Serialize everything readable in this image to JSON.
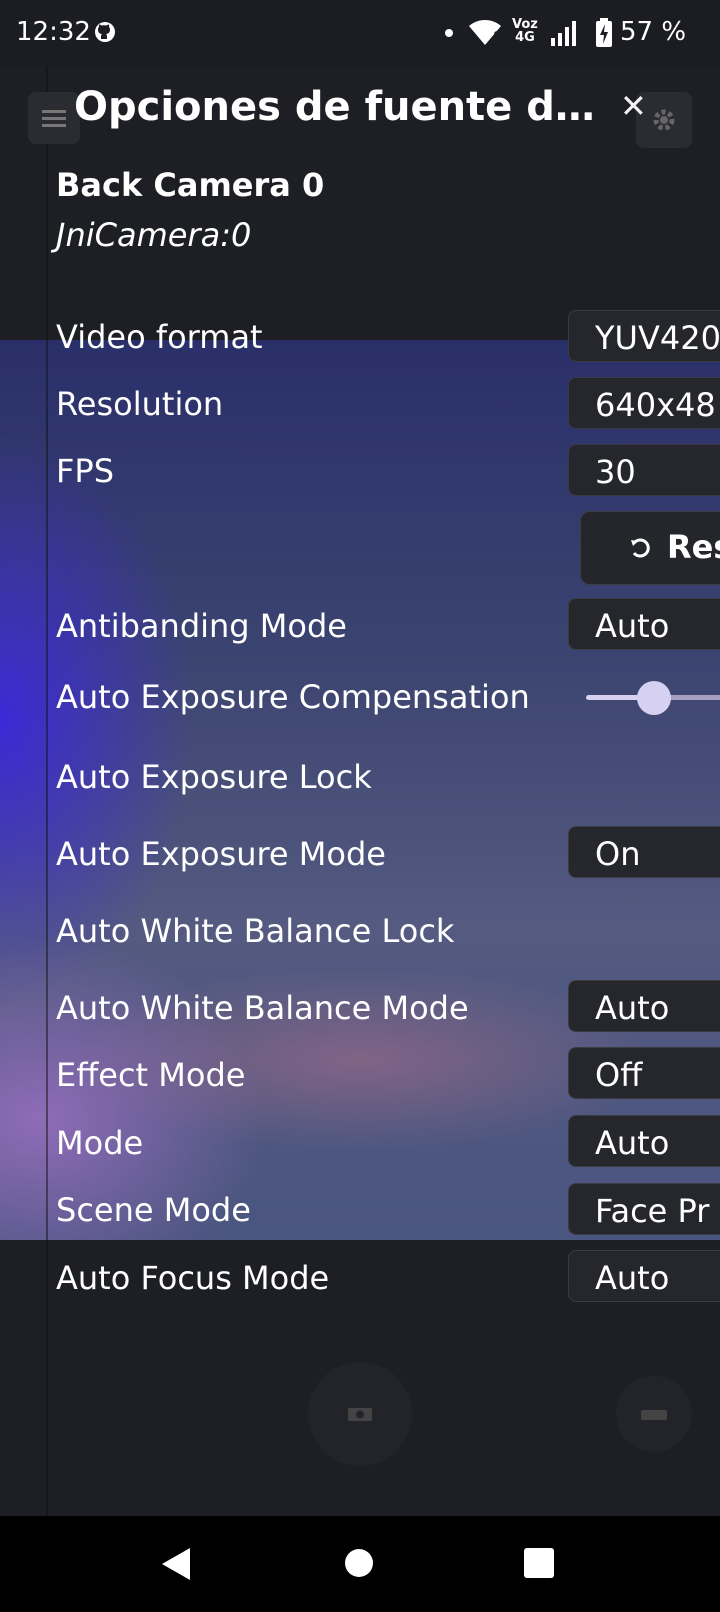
{
  "status_bar": {
    "time": "12:32",
    "network_top": "Voz",
    "network_bottom": "4G",
    "battery": "57 %"
  },
  "header": {
    "title": "Opciones de fuente d…",
    "close_icon": "close-icon",
    "menu_icon": "menu-icon",
    "settings_icon": "gear-icon"
  },
  "camera": {
    "name": "Back Camera 0",
    "id": "JniCamera:0"
  },
  "rows": {
    "video_format": {
      "label": "Video format",
      "value": "YUV420"
    },
    "resolution": {
      "label": "Resolution",
      "value": "640x48"
    },
    "fps": {
      "label": "FPS",
      "value": "30"
    },
    "reset": {
      "label": "Res"
    },
    "antibanding": {
      "label": "Antibanding Mode",
      "value": "Auto"
    },
    "ae_comp": {
      "label": "Auto Exposure Compensation"
    },
    "ae_lock": {
      "label": "Auto Exposure Lock"
    },
    "ae_mode": {
      "label": "Auto Exposure Mode",
      "value": "On"
    },
    "awb_lock": {
      "label": "Auto White Balance Lock"
    },
    "awb_mode": {
      "label": "Auto White Balance Mode",
      "value": "Auto"
    },
    "effect_mode": {
      "label": "Effect Mode",
      "value": "Off"
    },
    "mode": {
      "label": "Mode",
      "value": "Auto"
    },
    "scene_mode": {
      "label": "Scene Mode",
      "value": "Face Pr"
    },
    "af_mode": {
      "label": "Auto Focus Mode",
      "value": "Auto"
    }
  },
  "colors": {
    "background": "#1d1f24",
    "control_bg": "#25272d",
    "slider_accent": "#d6d0f2"
  }
}
